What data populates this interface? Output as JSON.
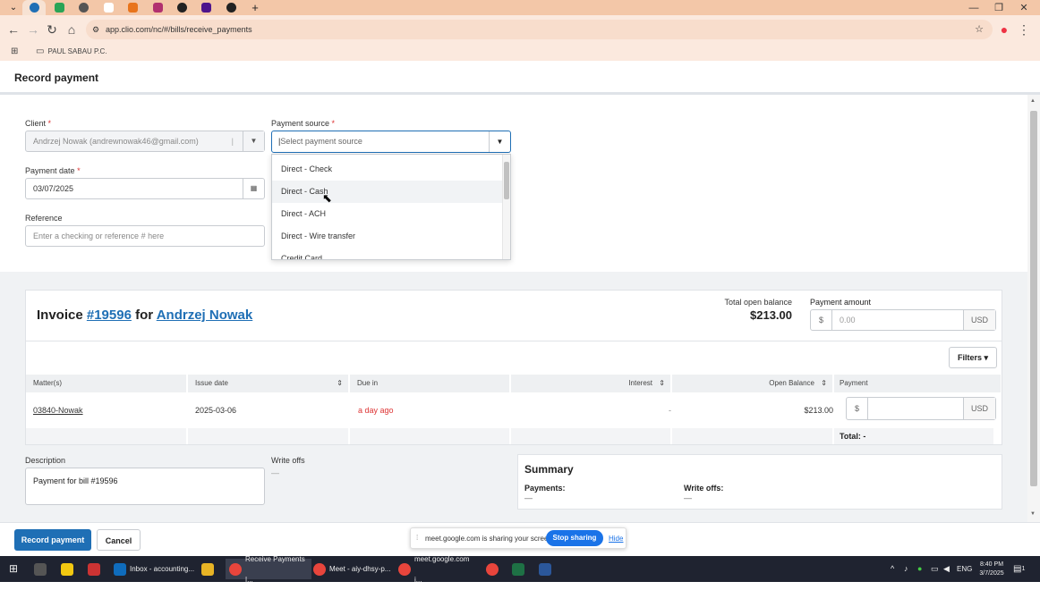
{
  "browser": {
    "url": "app.clio.com/nc/#/bills/receive_payments",
    "bookmark_folder": "PAUL SABAU P.C.",
    "colors": {
      "tabbar": "#f3c7a8",
      "toolbar": "#fbe9de"
    }
  },
  "page": {
    "title": "Record payment",
    "client_label": "Client",
    "client_value": "Andrzej Nowak (andrewnowak46@gmail.com)",
    "payment_source_label": "Payment source",
    "payment_source_placeholder": "Select payment source",
    "payment_source_options": [
      "Direct - Check",
      "Direct - Cash",
      "Direct - ACH",
      "Direct - Wire transfer",
      "Credit Card"
    ],
    "payment_date_label": "Payment date",
    "payment_date_value": "03/07/2025",
    "reference_label": "Reference",
    "reference_placeholder": "Enter a checking or reference # here",
    "required_mark": "*"
  },
  "invoice": {
    "prefix": "Invoice",
    "number": "#19596",
    "for_text": "for",
    "client_name": "Andrzej Nowak",
    "total_open_balance_label": "Total open balance",
    "total_open_balance": "$213.00",
    "payment_amount_label": "Payment amount",
    "currency_symbol": "$",
    "payment_amount_placeholder": "0.00",
    "currency": "USD",
    "filters_label": "Filters",
    "columns": [
      "Matter(s)",
      "Issue date",
      "Due in",
      "Interest",
      "Open Balance",
      "Payment"
    ],
    "row": {
      "matter": "03840-Nowak",
      "issue_date": "2025-03-06",
      "due_in": "a day ago",
      "interest": "-",
      "open_balance": "$213.00",
      "payment_currency_symbol": "$",
      "currency": "USD"
    },
    "total_label": "Total: -"
  },
  "bottom": {
    "description_label": "Description",
    "description_value": "Payment for bill #19596",
    "write_offs_label": "Write offs",
    "write_offs_value": "—",
    "summary_title": "Summary",
    "summary_payments_label": "Payments:",
    "summary_payments_value": "—",
    "summary_writeoffs_label": "Write offs:",
    "summary_writeoffs_value": "—"
  },
  "actions": {
    "record_payment": "Record payment",
    "cancel": "Cancel"
  },
  "share_bar": {
    "text": "meet.google.com is sharing your screen.",
    "stop": "Stop sharing",
    "hide": "Hide"
  },
  "taskbar": {
    "items": [
      "Inbox - accounting...",
      "Receive Payments |...",
      "Meet - aiy-dhsy-p...",
      "meet.google.com i..."
    ],
    "language": "ENG",
    "time": "8:40 PM",
    "date": "3/7/2025",
    "notifications": "1"
  },
  "colors": {
    "accent": "#1f6fb5",
    "danger": "#d33",
    "gray_bg": "#f0f2f4"
  }
}
